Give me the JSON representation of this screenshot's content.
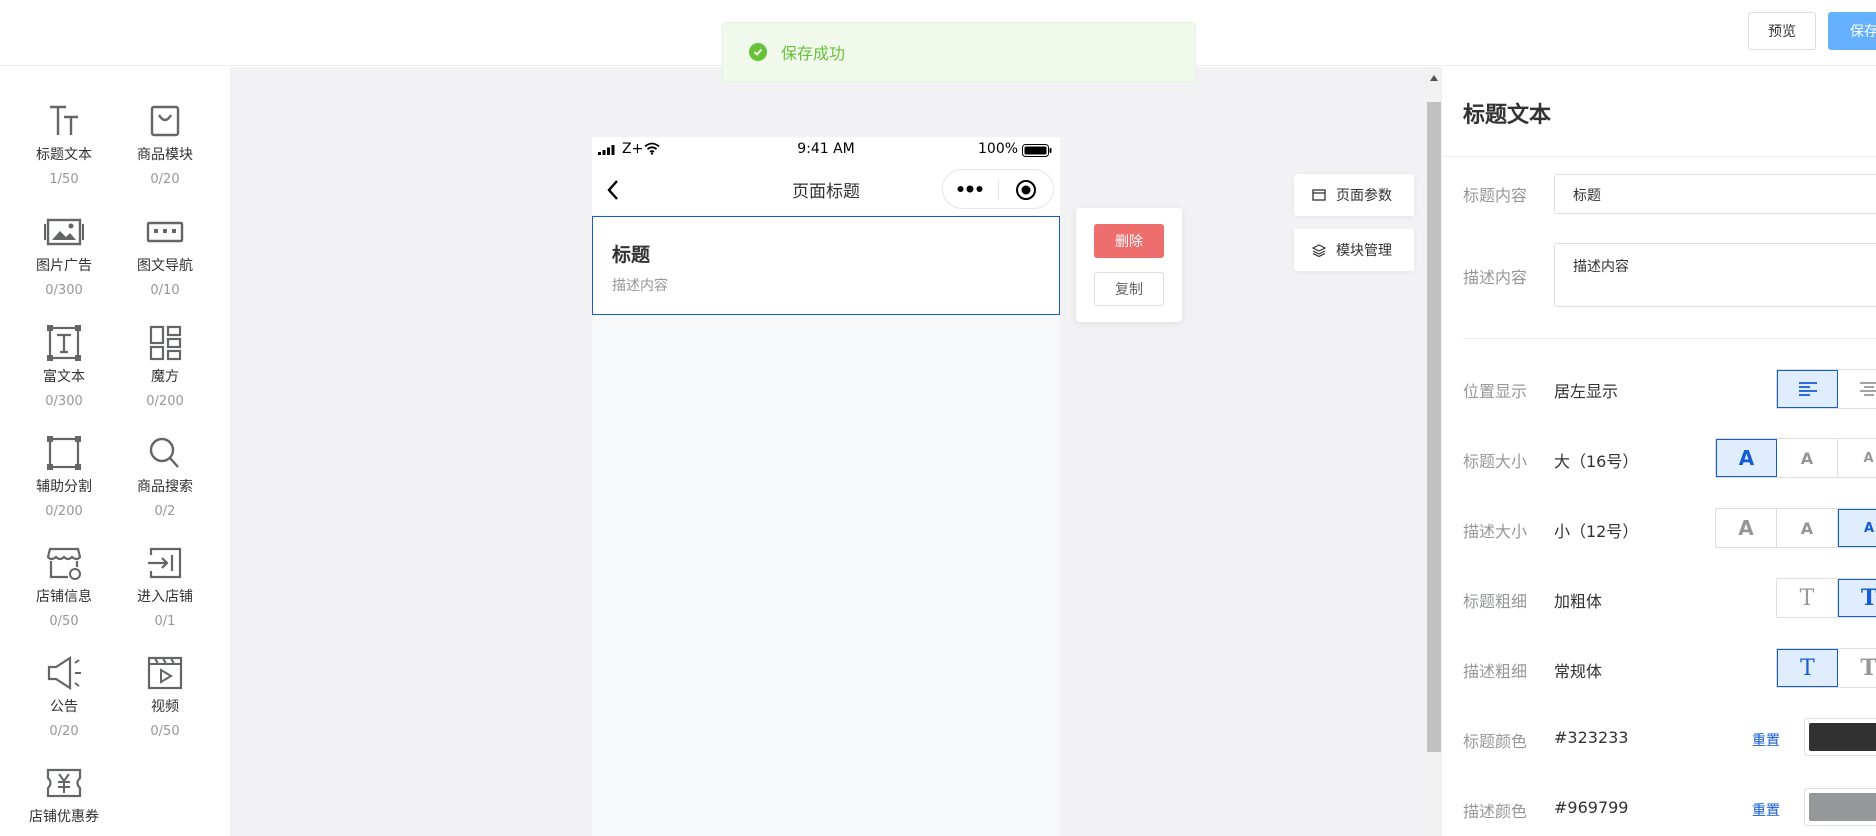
{
  "header": {
    "preview_label": "预览",
    "save_label": "保存"
  },
  "toast": {
    "text": "保存成功"
  },
  "components": [
    {
      "label": "标题文本",
      "count": "1/50",
      "icon": "title-text-icon"
    },
    {
      "label": "商品模块",
      "count": "0/20",
      "icon": "shopping-bag-icon"
    },
    {
      "label": "图片广告",
      "count": "0/300",
      "icon": "image-ad-icon"
    },
    {
      "label": "图文导航",
      "count": "0/10",
      "icon": "image-nav-icon"
    },
    {
      "label": "富文本",
      "count": "0/300",
      "icon": "rich-text-icon"
    },
    {
      "label": "魔方",
      "count": "0/200",
      "icon": "cube-grid-icon"
    },
    {
      "label": "辅助分割",
      "count": "0/200",
      "icon": "divider-icon"
    },
    {
      "label": "商品搜索",
      "count": "0/2",
      "icon": "search-icon"
    },
    {
      "label": "店铺信息",
      "count": "0/50",
      "icon": "shop-info-icon"
    },
    {
      "label": "进入店铺",
      "count": "0/1",
      "icon": "enter-shop-icon"
    },
    {
      "label": "公告",
      "count": "0/20",
      "icon": "megaphone-icon"
    },
    {
      "label": "视频",
      "count": "0/50",
      "icon": "video-icon"
    },
    {
      "label": "店铺优惠券",
      "count": "",
      "icon": "coupon-icon"
    }
  ],
  "phone": {
    "carrier": "Z+",
    "time": "9:41 AM",
    "battery": "100%",
    "nav_title": "页面标题",
    "title_block": {
      "title": "标题",
      "description": "描述内容"
    }
  },
  "actions": {
    "delete_label": "删除",
    "copy_label": "复制"
  },
  "side_buttons": {
    "page_params": "页面参数",
    "module_manage": "模块管理"
  },
  "settings": {
    "panel_title": "标题文本",
    "title_content": {
      "label": "标题内容",
      "value": "标题"
    },
    "desc_content": {
      "label": "描述内容",
      "value": "描述内容"
    },
    "position": {
      "label": "位置显示",
      "value": "居左显示"
    },
    "title_size": {
      "label": "标题大小",
      "value": "大（16号）"
    },
    "desc_size": {
      "label": "描述大小",
      "value": "小（12号）"
    },
    "title_weight": {
      "label": "标题粗细",
      "value": "加粗体"
    },
    "desc_weight": {
      "label": "描述粗细",
      "value": "常规体"
    },
    "title_color": {
      "label": "标题颜色",
      "value": "#323233",
      "reset": "重置",
      "swatch": "#323233"
    },
    "desc_color": {
      "label": "描述颜色",
      "value": "#969799",
      "reset": "重置",
      "swatch": "#969799"
    },
    "size_glyph": "A",
    "weight_glyph": "T"
  },
  "colors": {
    "accent": "#155bd4",
    "success": "#67c23a",
    "danger": "#ee6e6e",
    "save_button": "#66b1ff"
  }
}
